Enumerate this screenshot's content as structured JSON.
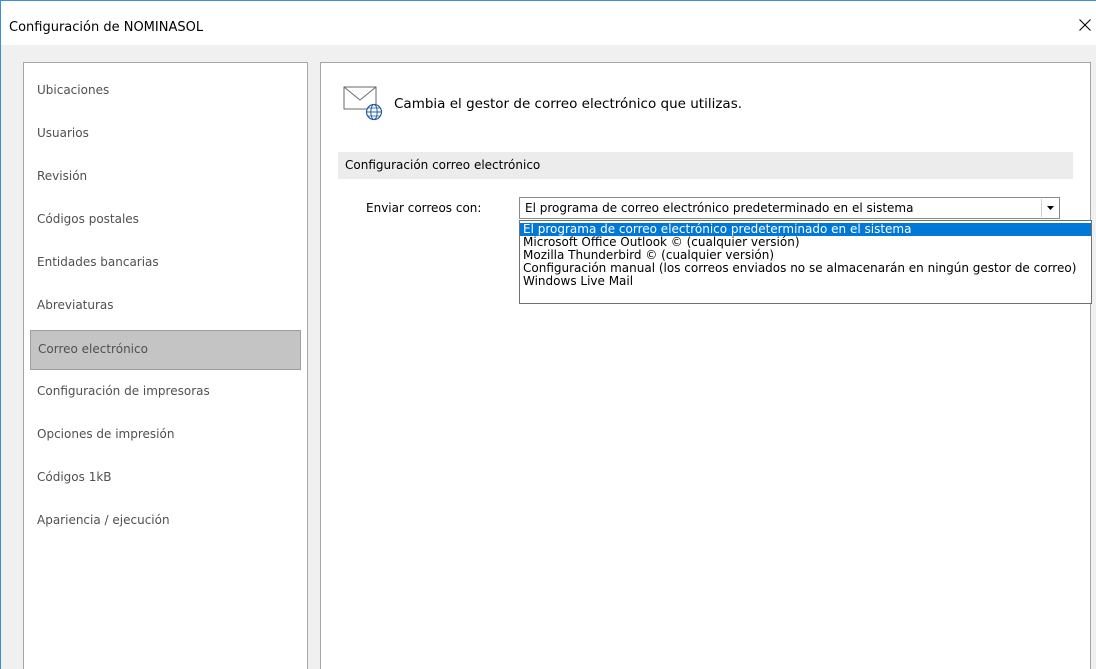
{
  "window": {
    "title": "Configuración de NOMINASOL"
  },
  "sidebar": {
    "items": [
      {
        "label": "Ubicaciones",
        "selected": false
      },
      {
        "label": "Usuarios",
        "selected": false
      },
      {
        "label": "Revisión",
        "selected": false
      },
      {
        "label": "Códigos postales",
        "selected": false
      },
      {
        "label": "Entidades bancarias",
        "selected": false
      },
      {
        "label": "Abreviaturas",
        "selected": false
      },
      {
        "label": "Correo electrónico",
        "selected": true
      },
      {
        "label": "Configuración de impresoras",
        "selected": false
      },
      {
        "label": "Opciones de impresión",
        "selected": false
      },
      {
        "label": "Códigos 1kB",
        "selected": false
      },
      {
        "label": "Apariencia / ejecución",
        "selected": false
      }
    ]
  },
  "content": {
    "header_text": "Cambia el gestor de correo electrónico que utilizas.",
    "header_icon": "mail-globe-icon",
    "section_title": "Configuración correo electrónico",
    "send_with": {
      "label": "Enviar correos con:",
      "selected_value": "El programa de correo electrónico predeterminado en el sistema",
      "options": [
        "El programa de correo electrónico predeterminado en el sistema",
        "Microsoft Office Outlook © (cualquier versión)",
        "Mozilla Thunderbird © (cualquier versión)",
        "Configuración manual (los correos enviados no se almacenarán en ningún gestor de correo)",
        "Windows Live Mail"
      ],
      "highlighted_option": 0
    }
  },
  "colors": {
    "accent": "#0078d7",
    "selected_sidebar": "#c4c4c4",
    "window_border": "#3c8fd6"
  }
}
